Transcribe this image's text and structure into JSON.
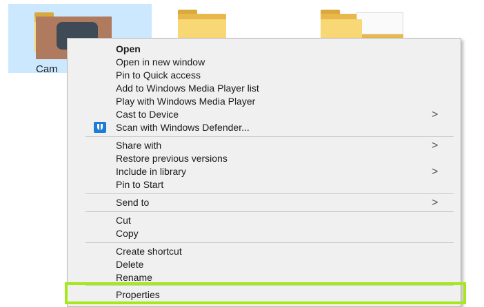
{
  "tiles": [
    {
      "label": "Cam",
      "selected": true
    },
    {
      "label": "",
      "selected": false
    },
    {
      "label": "",
      "selected": false
    }
  ],
  "colors": {
    "selection": "#cce8ff",
    "menu_bg": "#f0f0f0",
    "highlight": "#a5e81c",
    "folder": "#f8d775",
    "defender": "#1d7cd6"
  },
  "menu": {
    "items": [
      {
        "label": "Open",
        "bold": true
      },
      {
        "label": "Open in new window"
      },
      {
        "label": "Pin to Quick access"
      },
      {
        "label": "Add to Windows Media Player list"
      },
      {
        "label": "Play with Windows Media Player"
      },
      {
        "label": "Cast to Device",
        "submenu": true
      },
      {
        "label": "Scan with Windows Defender...",
        "icon": "windows-defender-icon"
      },
      {
        "label": "Share with",
        "submenu": true
      },
      {
        "label": "Restore previous versions"
      },
      {
        "label": "Include in library",
        "submenu": true
      },
      {
        "label": "Pin to Start"
      },
      {
        "label": "Send to",
        "submenu": true
      },
      {
        "label": "Cut"
      },
      {
        "label": "Copy"
      },
      {
        "label": "Create shortcut"
      },
      {
        "label": "Delete"
      },
      {
        "label": "Rename"
      },
      {
        "label": "Properties",
        "highlighted": true
      }
    ],
    "submenu_arrow": ">"
  }
}
